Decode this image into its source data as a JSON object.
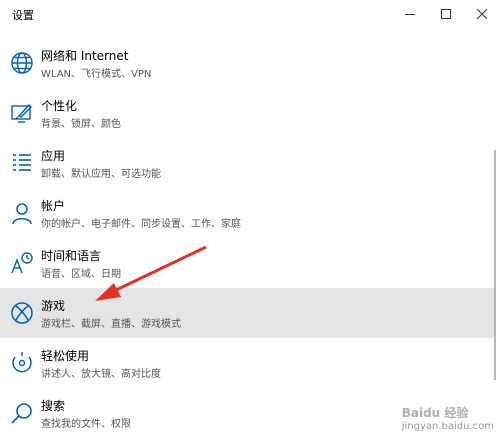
{
  "window": {
    "title": "设置",
    "controls": {
      "minimize": "minimize-icon",
      "maximize": "maximize-icon",
      "close": "close-icon"
    }
  },
  "categories": [
    {
      "title": "网络和 Internet",
      "subtitle": "WLAN、飞行模式、VPN",
      "icon": "globe-icon"
    },
    {
      "title": "个性化",
      "subtitle": "背景、锁屏、颜色",
      "icon": "personalization-icon"
    },
    {
      "title": "应用",
      "subtitle": "卸载、默认应用、可选功能",
      "icon": "apps-list-icon"
    },
    {
      "title": "帐户",
      "subtitle": "你的帐户、电子邮件、同步设置、工作、家庭",
      "icon": "person-icon"
    },
    {
      "title": "时间和语言",
      "subtitle": "语音、区域、日期",
      "icon": "time-language-icon"
    },
    {
      "title": "游戏",
      "subtitle": "游戏栏、截屏、直播、游戏模式",
      "icon": "xbox-icon",
      "selected": true
    },
    {
      "title": "轻松使用",
      "subtitle": "讲述人、放大镜、高对比度",
      "icon": "ease-of-access-icon"
    },
    {
      "title": "搜索",
      "subtitle": "查找我的文件、权限",
      "icon": "search-icon"
    }
  ],
  "annotation": {
    "color": "#e0322b"
  },
  "watermark": {
    "brand": "Baidu 经验",
    "url": "jingyan.baidu.com"
  },
  "colors": {
    "selected_bg": "#e5e5e5",
    "icon_blue": "#0063b1",
    "text_secondary": "#555555"
  }
}
